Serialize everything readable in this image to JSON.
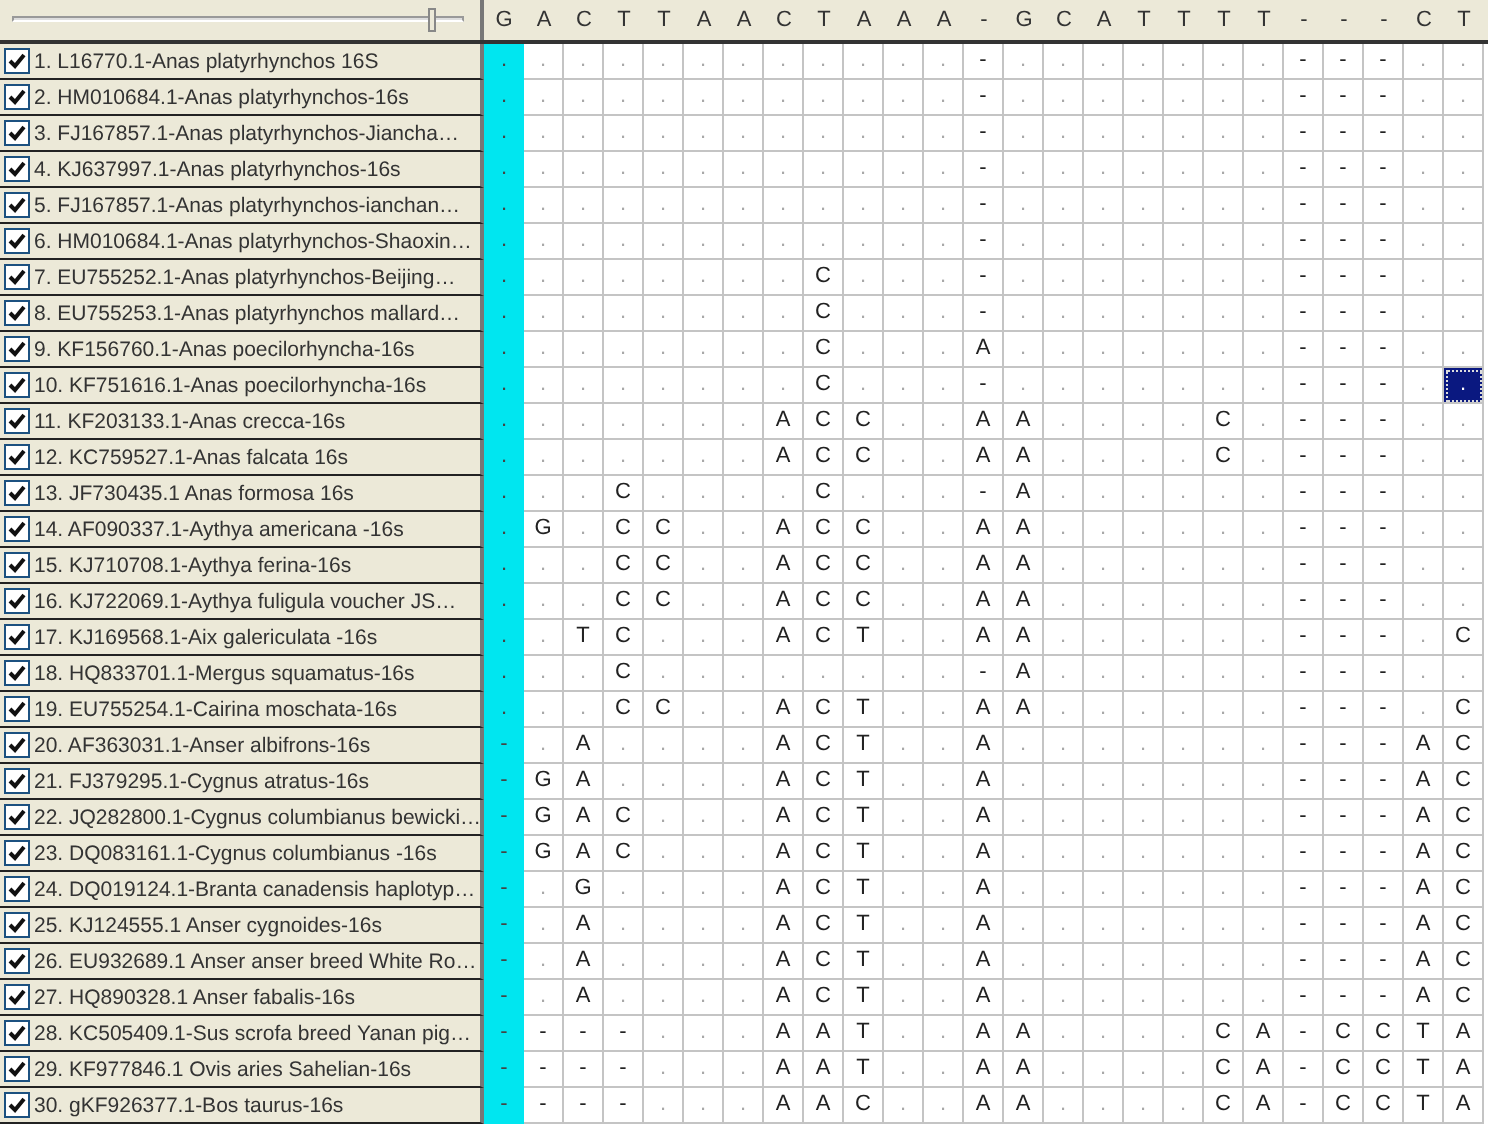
{
  "header": {
    "slider": {
      "level": 0.93
    },
    "sites": [
      "G",
      "A",
      "C",
      "T",
      "T",
      "A",
      "A",
      "C",
      "T",
      "A",
      "A",
      "A",
      "-",
      "G",
      "C",
      "A",
      "T",
      "T",
      "T",
      "T",
      "-",
      "-",
      "-",
      "C",
      "T"
    ]
  },
  "sequences": [
    {
      "name": "1. L16770.1-Anas platyrhynchos 16S",
      "checked": true,
      "cells": [
        ".",
        ".",
        ".",
        ".",
        ".",
        ".",
        ".",
        ".",
        ".",
        ".",
        ".",
        ".",
        "-",
        ".",
        ".",
        ".",
        ".",
        ".",
        ".",
        ".",
        "-",
        "-",
        "-",
        ".",
        "."
      ]
    },
    {
      "name": "2. HM010684.1-Anas platyrhynchos-16s",
      "checked": true,
      "cells": [
        ".",
        ".",
        ".",
        ".",
        ".",
        ".",
        ".",
        ".",
        ".",
        ".",
        ".",
        ".",
        "-",
        ".",
        ".",
        ".",
        ".",
        ".",
        ".",
        ".",
        "-",
        "-",
        "-",
        ".",
        "."
      ]
    },
    {
      "name": "3. FJ167857.1-Anas platyrhynchos-Jiancha…",
      "checked": true,
      "cells": [
        ".",
        ".",
        ".",
        ".",
        ".",
        ".",
        ".",
        ".",
        ".",
        ".",
        ".",
        ".",
        "-",
        ".",
        ".",
        ".",
        ".",
        ".",
        ".",
        ".",
        "-",
        "-",
        "-",
        ".",
        "."
      ]
    },
    {
      "name": "4. KJ637997.1-Anas platyrhynchos-16s",
      "checked": true,
      "cells": [
        ".",
        ".",
        ".",
        ".",
        ".",
        ".",
        ".",
        ".",
        ".",
        ".",
        ".",
        ".",
        "-",
        ".",
        ".",
        ".",
        ".",
        ".",
        ".",
        ".",
        "-",
        "-",
        "-",
        ".",
        "."
      ]
    },
    {
      "name": "5. FJ167857.1-Anas platyrhynchos-ianchan…",
      "checked": true,
      "cells": [
        ".",
        ".",
        ".",
        ".",
        ".",
        ".",
        ".",
        ".",
        ".",
        ".",
        ".",
        ".",
        "-",
        ".",
        ".",
        ".",
        ".",
        ".",
        ".",
        ".",
        "-",
        "-",
        "-",
        ".",
        "."
      ]
    },
    {
      "name": "6. HM010684.1-Anas platyrhynchos-Shaoxin…",
      "checked": true,
      "cells": [
        ".",
        ".",
        ".",
        ".",
        ".",
        ".",
        ".",
        ".",
        ".",
        ".",
        ".",
        ".",
        "-",
        ".",
        ".",
        ".",
        ".",
        ".",
        ".",
        ".",
        "-",
        "-",
        "-",
        ".",
        "."
      ]
    },
    {
      "name": "7. EU755252.1-Anas platyrhynchos-Beijing…",
      "checked": true,
      "cells": [
        ".",
        ".",
        ".",
        ".",
        ".",
        ".",
        ".",
        ".",
        "C",
        ".",
        ".",
        ".",
        "-",
        ".",
        ".",
        ".",
        ".",
        ".",
        ".",
        ".",
        "-",
        "-",
        "-",
        ".",
        "."
      ]
    },
    {
      "name": "8. EU755253.1-Anas platyrhynchos mallard…",
      "checked": true,
      "cells": [
        ".",
        ".",
        ".",
        ".",
        ".",
        ".",
        ".",
        ".",
        "C",
        ".",
        ".",
        ".",
        "-",
        ".",
        ".",
        ".",
        ".",
        ".",
        ".",
        ".",
        "-",
        "-",
        "-",
        ".",
        "."
      ]
    },
    {
      "name": "9. KF156760.1-Anas poecilorhyncha-16s",
      "checked": true,
      "cells": [
        ".",
        ".",
        ".",
        ".",
        ".",
        ".",
        ".",
        ".",
        "C",
        ".",
        ".",
        ".",
        "A",
        ".",
        ".",
        ".",
        ".",
        ".",
        ".",
        ".",
        "-",
        "-",
        "-",
        ".",
        "."
      ]
    },
    {
      "name": "10. KF751616.1-Anas poecilorhyncha-16s",
      "checked": true,
      "cells": [
        ".",
        ".",
        ".",
        ".",
        ".",
        ".",
        ".",
        ".",
        "C",
        ".",
        ".",
        ".",
        "-",
        ".",
        ".",
        ".",
        ".",
        ".",
        ".",
        ".",
        "-",
        "-",
        "-",
        ".",
        {
          "base": ".",
          "selected": true
        }
      ]
    },
    {
      "name": "11. KF203133.1-Anas crecca-16s",
      "checked": true,
      "cells": [
        ".",
        ".",
        ".",
        ".",
        ".",
        ".",
        ".",
        "A",
        "C",
        "C",
        ".",
        ".",
        "A",
        "A",
        ".",
        ".",
        ".",
        ".",
        "C",
        ".",
        "-",
        "-",
        "-",
        ".",
        "."
      ]
    },
    {
      "name": "12. KC759527.1-Anas falcata 16s",
      "checked": true,
      "cells": [
        ".",
        ".",
        ".",
        ".",
        ".",
        ".",
        ".",
        "A",
        "C",
        "C",
        ".",
        ".",
        "A",
        "A",
        ".",
        ".",
        ".",
        ".",
        "C",
        ".",
        "-",
        "-",
        "-",
        ".",
        "."
      ]
    },
    {
      "name": "13. JF730435.1 Anas formosa 16s",
      "checked": true,
      "cells": [
        ".",
        ".",
        ".",
        "C",
        ".",
        ".",
        ".",
        ".",
        "C",
        ".",
        ".",
        ".",
        "-",
        "A",
        ".",
        ".",
        ".",
        ".",
        ".",
        ".",
        "-",
        "-",
        "-",
        ".",
        "."
      ]
    },
    {
      "name": "14. AF090337.1-Aythya americana -16s",
      "checked": true,
      "cells": [
        ".",
        "G",
        ".",
        "C",
        "C",
        ".",
        ".",
        "A",
        "C",
        "C",
        ".",
        ".",
        "A",
        "A",
        ".",
        ".",
        ".",
        ".",
        ".",
        ".",
        "-",
        "-",
        "-",
        ".",
        "."
      ]
    },
    {
      "name": "15. KJ710708.1-Aythya ferina-16s",
      "checked": true,
      "cells": [
        ".",
        ".",
        ".",
        "C",
        "C",
        ".",
        ".",
        "A",
        "C",
        "C",
        ".",
        ".",
        "A",
        "A",
        ".",
        ".",
        ".",
        ".",
        ".",
        ".",
        "-",
        "-",
        "-",
        ".",
        "."
      ]
    },
    {
      "name": "16. KJ722069.1-Aythya fuligula voucher JS…",
      "checked": true,
      "cells": [
        ".",
        ".",
        ".",
        "C",
        "C",
        ".",
        ".",
        "A",
        "C",
        "C",
        ".",
        ".",
        "A",
        "A",
        ".",
        ".",
        ".",
        ".",
        ".",
        ".",
        "-",
        "-",
        "-",
        ".",
        "."
      ]
    },
    {
      "name": "17. KJ169568.1-Aix galericulata -16s",
      "checked": true,
      "cells": [
        ".",
        ".",
        "T",
        "C",
        ".",
        ".",
        ".",
        "A",
        "C",
        "T",
        ".",
        ".",
        "A",
        "A",
        ".",
        ".",
        ".",
        ".",
        ".",
        ".",
        "-",
        "-",
        "-",
        ".",
        "C"
      ]
    },
    {
      "name": "18. HQ833701.1-Mergus squamatus-16s",
      "checked": true,
      "cells": [
        ".",
        ".",
        ".",
        "C",
        ".",
        ".",
        ".",
        ".",
        ".",
        ".",
        ".",
        ".",
        "-",
        "A",
        ".",
        ".",
        ".",
        ".",
        ".",
        ".",
        "-",
        "-",
        "-",
        ".",
        "."
      ]
    },
    {
      "name": "19. EU755254.1-Cairina moschata-16s",
      "checked": true,
      "cells": [
        ".",
        ".",
        ".",
        "C",
        "C",
        ".",
        ".",
        "A",
        "C",
        "T",
        ".",
        ".",
        "A",
        "A",
        ".",
        ".",
        ".",
        ".",
        ".",
        ".",
        "-",
        "-",
        "-",
        ".",
        "C"
      ]
    },
    {
      "name": "20. AF363031.1-Anser albifrons-16s",
      "checked": true,
      "cells": [
        "-",
        ".",
        "A",
        ".",
        ".",
        ".",
        ".",
        "A",
        "C",
        "T",
        ".",
        ".",
        "A",
        ".",
        ".",
        ".",
        ".",
        ".",
        ".",
        ".",
        "-",
        "-",
        "-",
        "A",
        "C"
      ]
    },
    {
      "name": "21. FJ379295.1-Cygnus atratus-16s",
      "checked": true,
      "cells": [
        "-",
        "G",
        "A",
        ".",
        ".",
        ".",
        ".",
        "A",
        "C",
        "T",
        ".",
        ".",
        "A",
        ".",
        ".",
        ".",
        ".",
        ".",
        ".",
        ".",
        "-",
        "-",
        "-",
        "A",
        "C"
      ]
    },
    {
      "name": "22. JQ282800.1-Cygnus columbianus bewicki…",
      "checked": true,
      "cells": [
        "-",
        "G",
        "A",
        "C",
        ".",
        ".",
        ".",
        "A",
        "C",
        "T",
        ".",
        ".",
        "A",
        ".",
        ".",
        ".",
        ".",
        ".",
        ".",
        ".",
        "-",
        "-",
        "-",
        "A",
        "C"
      ]
    },
    {
      "name": "23. DQ083161.1-Cygnus columbianus -16s",
      "checked": true,
      "cells": [
        "-",
        "G",
        "A",
        "C",
        ".",
        ".",
        ".",
        "A",
        "C",
        "T",
        ".",
        ".",
        "A",
        ".",
        ".",
        ".",
        ".",
        ".",
        ".",
        ".",
        "-",
        "-",
        "-",
        "A",
        "C"
      ]
    },
    {
      "name": "24. DQ019124.1-Branta canadensis haplotyp…",
      "checked": true,
      "cells": [
        "-",
        ".",
        "G",
        ".",
        ".",
        ".",
        ".",
        "A",
        "C",
        "T",
        ".",
        ".",
        "A",
        ".",
        ".",
        ".",
        ".",
        ".",
        ".",
        ".",
        "-",
        "-",
        "-",
        "A",
        "C"
      ]
    },
    {
      "name": "25. KJ124555.1 Anser cygnoides-16s",
      "checked": true,
      "cells": [
        "-",
        ".",
        "A",
        ".",
        ".",
        ".",
        ".",
        "A",
        "C",
        "T",
        ".",
        ".",
        "A",
        ".",
        ".",
        ".",
        ".",
        ".",
        ".",
        ".",
        "-",
        "-",
        "-",
        "A",
        "C"
      ]
    },
    {
      "name": "26. EU932689.1 Anser anser breed White Ro…",
      "checked": true,
      "cells": [
        "-",
        ".",
        "A",
        ".",
        ".",
        ".",
        ".",
        "A",
        "C",
        "T",
        ".",
        ".",
        "A",
        ".",
        ".",
        ".",
        ".",
        ".",
        ".",
        ".",
        "-",
        "-",
        "-",
        "A",
        "C"
      ]
    },
    {
      "name": "27. HQ890328.1 Anser fabalis-16s",
      "checked": true,
      "cells": [
        "-",
        ".",
        "A",
        ".",
        ".",
        ".",
        ".",
        "A",
        "C",
        "T",
        ".",
        ".",
        "A",
        ".",
        ".",
        ".",
        ".",
        ".",
        ".",
        ".",
        "-",
        "-",
        "-",
        "A",
        "C"
      ]
    },
    {
      "name": "28. KC505409.1-Sus scrofa breed Yanan pig…",
      "checked": true,
      "cells": [
        "-",
        "-",
        "-",
        "-",
        ".",
        ".",
        ".",
        "A",
        "A",
        "T",
        ".",
        ".",
        "A",
        "A",
        ".",
        ".",
        ".",
        ".",
        "C",
        "A",
        "-",
        "C",
        "C",
        "T",
        "A"
      ]
    },
    {
      "name": "29. KF977846.1 Ovis aries Sahelian-16s",
      "checked": true,
      "cells": [
        "-",
        "-",
        "-",
        "-",
        ".",
        ".",
        ".",
        "A",
        "A",
        "T",
        ".",
        ".",
        "A",
        "A",
        ".",
        ".",
        ".",
        ".",
        "C",
        "A",
        "-",
        "C",
        "C",
        "T",
        "A"
      ]
    },
    {
      "name": "30. gKF926377.1-Bos taurus-16s",
      "checked": true,
      "cells": [
        "-",
        "-",
        "-",
        "-",
        ".",
        ".",
        ".",
        "A",
        "A",
        "C",
        ".",
        ".",
        "A",
        "A",
        ".",
        ".",
        ".",
        ".",
        "C",
        "A",
        "-",
        "C",
        "C",
        "T",
        "A"
      ]
    }
  ]
}
